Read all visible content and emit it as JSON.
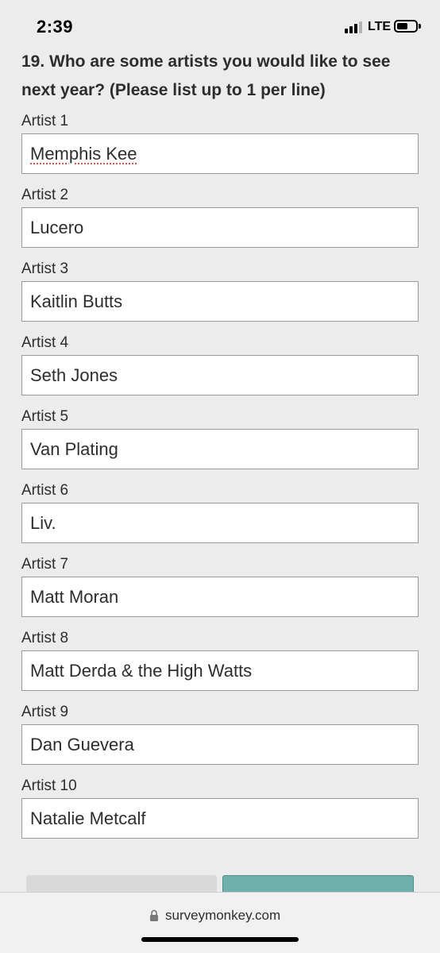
{
  "status_bar": {
    "time": "2:39",
    "network": "LTE"
  },
  "question": {
    "text": "19. Who are some artists you would like to see next year? (Please list up to 1 per line)"
  },
  "fields": [
    {
      "label": "Artist 1",
      "value": "Memphis Kee"
    },
    {
      "label": "Artist 2",
      "value": "Lucero"
    },
    {
      "label": "Artist 3",
      "value": "Kaitlin Butts"
    },
    {
      "label": "Artist 4",
      "value": "Seth Jones"
    },
    {
      "label": "Artist 5",
      "value": "Van Plating"
    },
    {
      "label": "Artist 6",
      "value": "Liv."
    },
    {
      "label": "Artist 7",
      "value": "Matt Moran"
    },
    {
      "label": "Artist 8",
      "value": "Matt Derda & the High Watts"
    },
    {
      "label": "Artist 9",
      "value": "Dan Guevera"
    },
    {
      "label": "Artist 10",
      "value": "Natalie Metcalf"
    }
  ],
  "browser": {
    "url": "surveymonkey.com"
  },
  "icons": {
    "lock": "lock-icon",
    "signal": "cellular-signal-icon",
    "battery": "battery-icon"
  },
  "colors": {
    "page_background": "#ececec",
    "next_button": "#6fb0ad",
    "previous_button": "#d9d9d9",
    "spellcheck_underline": "#e05050"
  }
}
